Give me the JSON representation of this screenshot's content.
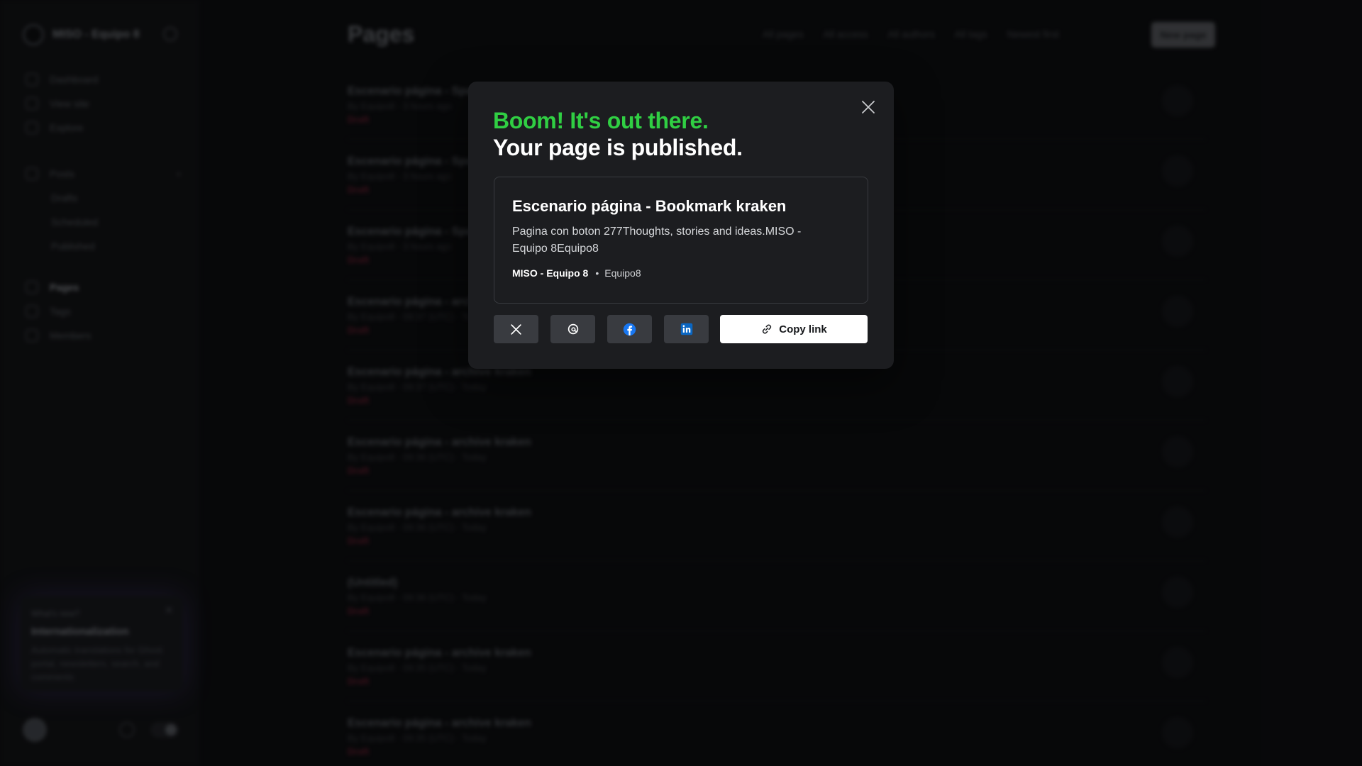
{
  "sidebar": {
    "brand": "MISO - Equipo 8",
    "nav_top": [
      "Dashboard",
      "View site",
      "Explore"
    ],
    "nav_posts": {
      "label": "Posts",
      "subs": [
        "Drafts",
        "Scheduled",
        "Published"
      ]
    },
    "nav_bottom": [
      "Pages",
      "Tags",
      "Members"
    ],
    "promo": {
      "small": "What's new?",
      "title": "Internationalization",
      "text": "Automatic translations for Ghost portal, newsletters, search, and comments"
    }
  },
  "main": {
    "title": "Pages",
    "filters": [
      "All pages",
      "All access",
      "All authors",
      "All tags",
      "Newest first"
    ],
    "new_button": "New page",
    "rows": [
      {
        "title": "Escenario página - Spa",
        "meta": "By Equipo8 · 3 hours ago",
        "status": "Draft"
      },
      {
        "title": "Escenario página - Spa",
        "meta": "By Equipo8 · 3 hours ago",
        "status": "Draft"
      },
      {
        "title": "Escenario página - Spa",
        "meta": "By Equipo8 · 3 hours ago",
        "status": "Draft"
      },
      {
        "title": "Escenario página - archive",
        "meta": "By Equipo8 · 09:37 (UTC) · Today",
        "status": "Draft"
      },
      {
        "title": "Escenario página - archive kraken",
        "meta": "By Equipo8 · 09:37 (UTC) · Today",
        "status": "Draft"
      },
      {
        "title": "Escenario página - archive kraken",
        "meta": "By Equipo8 · 09:36 (UTC) · Today",
        "status": "Draft"
      },
      {
        "title": "Escenario página - archive kraken",
        "meta": "By Equipo8 · 09:36 (UTC) · Today",
        "status": "Draft"
      },
      {
        "title": "(Untitled)",
        "meta": "By Equipo8 · 09:36 (UTC) · Today",
        "status": "Draft"
      },
      {
        "title": "Escenario página - archive kraken",
        "meta": "By Equipo8 · 09:35 (UTC) · Today",
        "status": "Draft"
      },
      {
        "title": "Escenario página - archive kraken",
        "meta": "By Equipo8 · 09:35 (UTC) · Today",
        "status": "Draft"
      }
    ]
  },
  "modal": {
    "heading_green": "Boom! It's out there.",
    "heading_white": "Your page is published.",
    "card": {
      "title": "Escenario página - Bookmark kraken",
      "description": "Pagina con boton 277Thoughts, stories and ideas.MISO - Equipo 8Equipo8",
      "site": "MISO - Equipo 8",
      "separator": "•",
      "author": "Equipo8"
    },
    "share": {
      "icons": [
        "x-icon",
        "threads-icon",
        "facebook-icon",
        "linkedin-icon"
      ],
      "copy_label": "Copy link"
    },
    "colors": {
      "accent_green": "#30cf43",
      "modal_bg": "#1c1d20",
      "facebook_blue": "#1877f2",
      "linkedin_blue": "#0a66c2"
    }
  }
}
